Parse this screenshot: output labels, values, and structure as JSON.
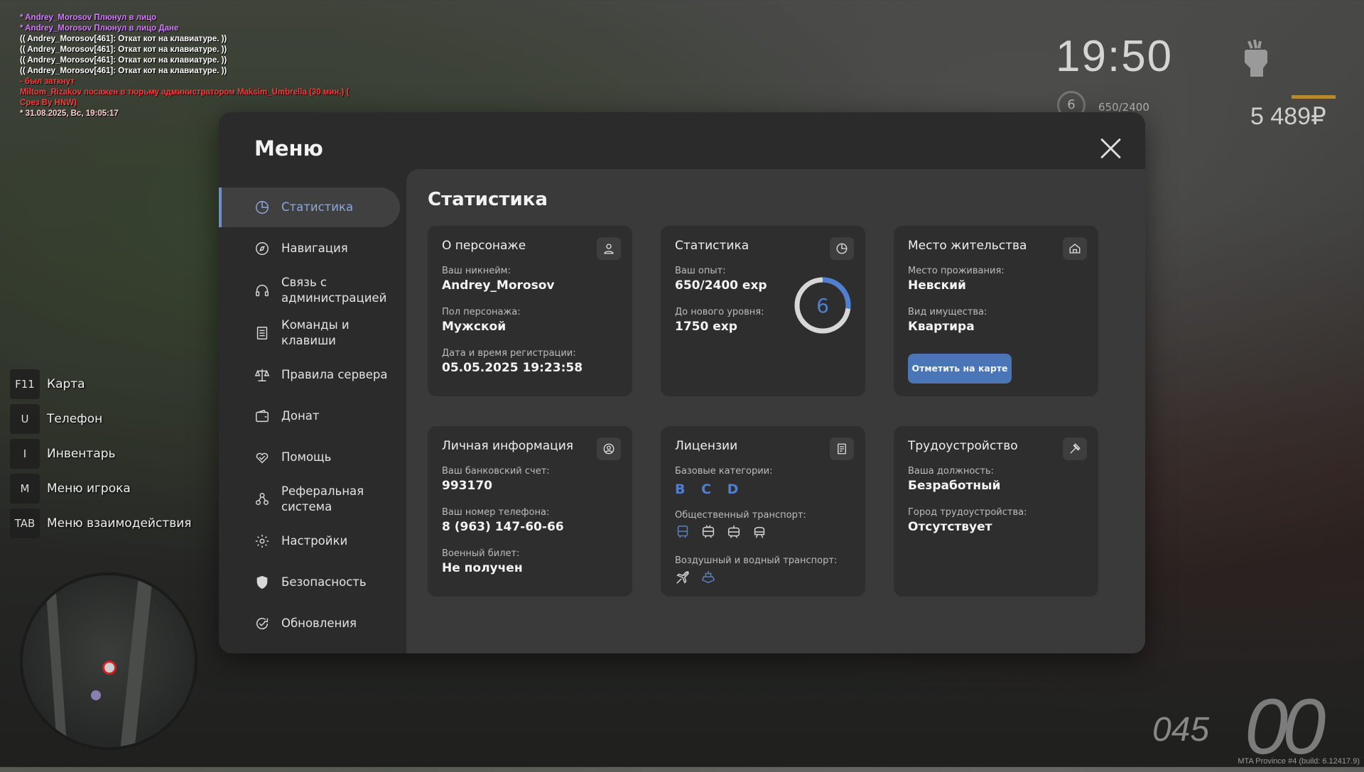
{
  "chat": [
    {
      "text": "* Andrey_Morosov Плюнул в лицо",
      "color": "#d77cff"
    },
    {
      "text": "* Andrey_Morosov Плюнул в лицо Дане",
      "color": "#d77cff"
    },
    {
      "text": "(( Andrey_Morosov[461]: Откат кот на клавиатуре. ))",
      "color": "#ffffff"
    },
    {
      "text": "(( Andrey_Morosov[461]: Откат кот на клавиатуре. ))",
      "color": "#ffffff"
    },
    {
      "text": "(( Andrey_Morosov[461]: Откат кот на клавиатуре. ))",
      "color": "#ffffff"
    },
    {
      "text": "(( Andrey_Morosov[461]: Откат кот на клавиатуре. ))",
      "color": "#ffffff"
    },
    {
      "text": "- был заткнут",
      "color": "#ff3b3b"
    },
    {
      "text": "Miltom_Rizakov посажен в тюрьму администратором Maksim_Umbrella (30 мин.) (",
      "color": "#ff3b3b"
    },
    {
      "text": "Срез By HNW)",
      "color": "#ff3b3b"
    },
    {
      "text": "* 31.08.2025, Вс, 19:05:17",
      "color": "#ffd0d0"
    }
  ],
  "hud": {
    "time": "19:50",
    "level": "6",
    "exp": "650/2400",
    "money": "5 489₽",
    "speed": "045",
    "gear": "00",
    "build": "MTA Province #4 (build: 6.12417.9)"
  },
  "keybinds": [
    {
      "key": "F11",
      "label": "Карта"
    },
    {
      "key": "U",
      "label": "Телефон"
    },
    {
      "key": "I",
      "label": "Инвентарь"
    },
    {
      "key": "M",
      "label": "Меню игрока"
    },
    {
      "key": "TAB",
      "label": "Меню взаимодействия"
    }
  ],
  "menu": {
    "title": "Меню",
    "nav": [
      {
        "label": "Статистика",
        "icon": "chart-pie-icon",
        "active": true
      },
      {
        "label": "Навигация",
        "icon": "compass-icon"
      },
      {
        "label": "Связь с администрацией",
        "icon": "headset-icon"
      },
      {
        "label": "Команды и клавиши",
        "icon": "document-list-icon"
      },
      {
        "label": "Правила сервера",
        "icon": "scales-icon"
      },
      {
        "label": "Донат",
        "icon": "wallet-icon"
      },
      {
        "label": "Помощь",
        "icon": "handshake-heart-icon"
      },
      {
        "label": "Реферальная система",
        "icon": "referral-people-icon"
      },
      {
        "label": "Настройки",
        "icon": "gear-icon"
      },
      {
        "label": "Безопасность",
        "icon": "shield-icon"
      },
      {
        "label": "Обновления",
        "icon": "refresh-check-icon"
      }
    ],
    "section_title": "Статистика",
    "cards": {
      "character": {
        "title": "О персонаже",
        "nickname_label": "Ваш никнейм:",
        "nickname": "Andrey_Morosov",
        "gender_label": "Пол персонажа:",
        "gender": "Мужской",
        "reg_label": "Дата и время регистрации:",
        "reg": "05.05.2025 19:23:58"
      },
      "stats": {
        "title": "Статистика",
        "exp_label": "Ваш опыт:",
        "exp": "650/2400 exp",
        "next_label": "До нового уровня:",
        "next": "1750 exp",
        "level": "6",
        "progress": 0.27
      },
      "residence": {
        "title": "Место жительства",
        "place_label": "Место проживания:",
        "place": "Невский",
        "type_label": "Вид имущества:",
        "type": "Квартира",
        "button": "Отметить на карте"
      },
      "personal": {
        "title": "Личная информация",
        "bank_label": "Ваш банковский счет:",
        "bank": "993170",
        "phone_label": "Ваш номер телефона:",
        "phone": "8 (963) 147-60-66",
        "military_label": "Военный билет:",
        "military": "Не получен"
      },
      "licenses": {
        "title": "Лицензии",
        "base_label": "Базовые категории:",
        "base": "B C D",
        "public_label": "Общественный транспорт:",
        "public_icons": [
          "bus-icon",
          "trolleybus-icon",
          "tram-icon",
          "metro-icon"
        ],
        "air_label": "Воздушный и водный транспорт:",
        "air_icons": [
          "plane-icon",
          "boat-icon"
        ]
      },
      "employment": {
        "title": "Трудоустройство",
        "position_label": "Ваша должность:",
        "position": "Безработный",
        "city_label": "Город трудоустройства:",
        "city": "Отсутствует"
      }
    }
  },
  "colors": {
    "accent": "#6d8fc4",
    "license_blue": "#4f7fd1",
    "button_blue": "#4a76b8"
  }
}
